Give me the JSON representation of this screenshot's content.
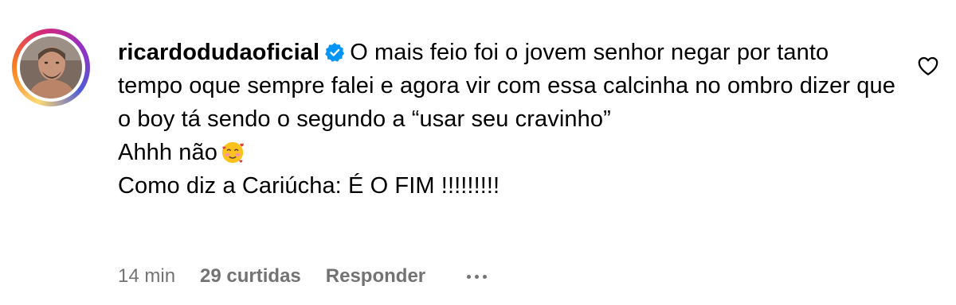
{
  "comment": {
    "username": "ricardodudaoficial",
    "verified": true,
    "text_first": "O mais feio foi o jovem senhor negar por tanto tempo oque sempre falei e agora vir com essa calcinha no ombro dizer que o boy tá sendo o segundo a “usar seu cravinho”",
    "line_ahhh": "Ahhh não",
    "line_emoji": "face-with-hearts-emoji",
    "line_last": "Como diz a Cariúcha: É O FIM !!!!!!!!!",
    "time": "14 min",
    "likes": "29 curtidas",
    "reply_label": "Responder",
    "more_icon": "more-dots-icon",
    "like_icon": "heart-outline-icon"
  },
  "colors": {
    "text": "#000000",
    "meta": "#737373",
    "verified": "#0095f6"
  }
}
